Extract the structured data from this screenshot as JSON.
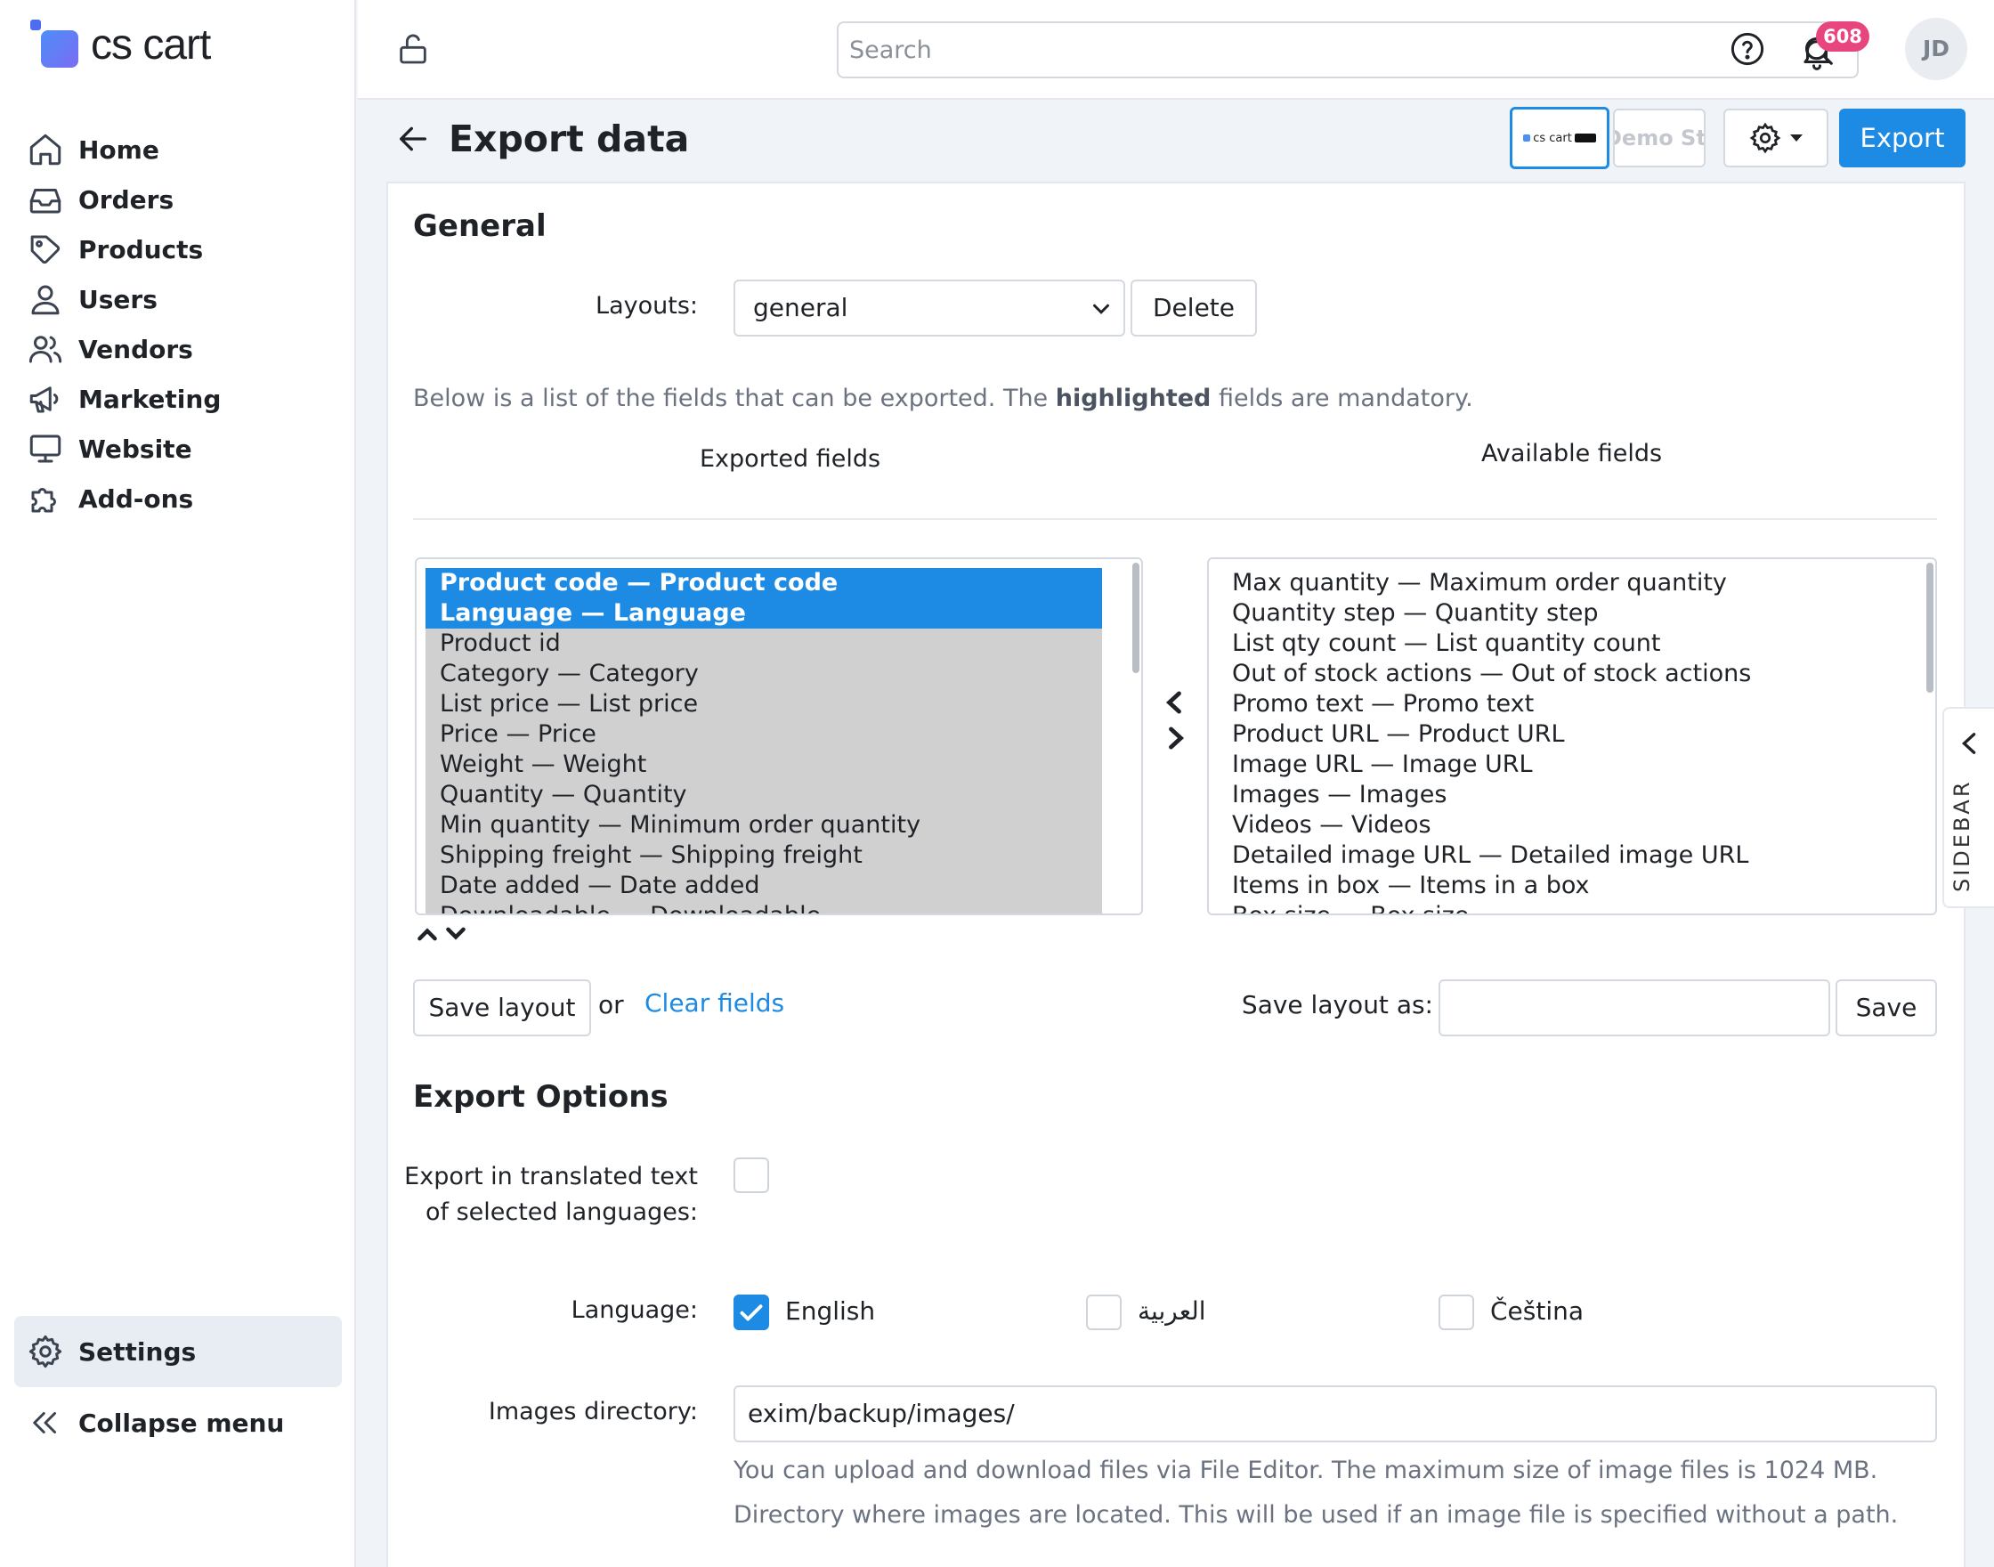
{
  "app": {
    "logo_text": "cs cart"
  },
  "nav": {
    "items": [
      {
        "label": "Home",
        "icon": "home-icon"
      },
      {
        "label": "Orders",
        "icon": "inbox-icon"
      },
      {
        "label": "Products",
        "icon": "tag-icon"
      },
      {
        "label": "Users",
        "icon": "user-icon"
      },
      {
        "label": "Vendors",
        "icon": "users-icon"
      },
      {
        "label": "Marketing",
        "icon": "megaphone-icon"
      },
      {
        "label": "Website",
        "icon": "monitor-icon"
      },
      {
        "label": "Add-ons",
        "icon": "puzzle-icon"
      }
    ],
    "settings_label": "Settings",
    "collapse_label": "Collapse menu"
  },
  "topbar": {
    "search_placeholder": "Search",
    "notifications_count": "608",
    "avatar_initials": "JD"
  },
  "header": {
    "title": "Export data",
    "storefront_b_label": "Demo Store",
    "export_label": "Export"
  },
  "general": {
    "heading": "General",
    "layouts_label": "Layouts:",
    "layout_selected": "general",
    "delete_label": "Delete",
    "desc_before": "Below is a list of the fields that can be exported. The ",
    "desc_bold": "highlighted",
    "desc_after": " fields are mandatory.",
    "exported_title": "Exported fields",
    "available_title": "Available fields",
    "exported_fields": [
      "Product code — Product code",
      "Language — Language",
      "Product id",
      "Category — Category",
      "List price — List price",
      "Price — Price",
      "Weight — Weight",
      "Quantity — Quantity",
      "Min quantity — Minimum order quantity",
      "Shipping freight — Shipping freight",
      "Date added — Date added",
      "Downloadable — Downloadable"
    ],
    "available_fields": [
      "Max quantity — Maximum order quantity",
      "Quantity step — Quantity step",
      "List qty count — List quantity count",
      "Out of stock actions — Out of stock actions",
      "Promo text — Promo text",
      "Product URL — Product URL",
      "Image URL — Image URL",
      "Images — Images",
      "Videos — Videos",
      "Detailed image URL — Detailed image URL",
      "Items in box — Items in a box",
      "Box size — Box size"
    ],
    "save_layout_label": "Save layout",
    "or_label": "or",
    "clear_fields_label": "Clear fields",
    "save_layout_as_label": "Save layout as:",
    "save_layout_as_value": "",
    "save_label": "Save"
  },
  "sidebar_tab_label": "SIDEBAR",
  "export_options": {
    "heading": "Export Options",
    "translated_label_line1": "Export in translated text",
    "translated_label_line2": "of selected languages:",
    "translated_checked": false,
    "language_label": "Language:",
    "languages": [
      {
        "label": "English",
        "checked": true
      },
      {
        "label": "العربية",
        "checked": false
      },
      {
        "label": "Čeština",
        "checked": false
      }
    ],
    "images_dir_label": "Images directory:",
    "images_dir_value": "exim/backup/images/",
    "hint_1": "You can upload and download files via File Editor. The maximum size of image files is 1024 MB.",
    "hint_2": "Directory where images are located. This will be used if an image file is specified without a path."
  },
  "colors": {
    "accent": "#1d8ae3",
    "badge": "#e8447e",
    "selection_bg": "#d0d0d0"
  }
}
